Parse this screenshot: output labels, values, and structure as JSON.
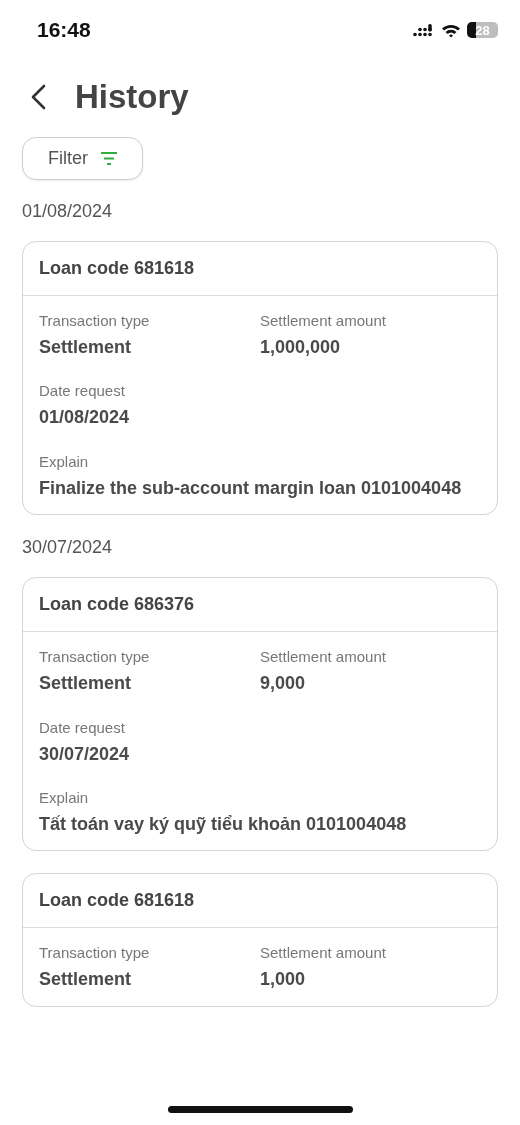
{
  "status_bar": {
    "time": "16:48",
    "battery": "28"
  },
  "header": {
    "title": "History"
  },
  "filter": {
    "label": "Filter"
  },
  "groups": [
    {
      "date": "01/08/2024",
      "cards": [
        {
          "title": "Loan code 681618",
          "fields": [
            {
              "kind": "half",
              "label": "Transaction type",
              "value": "Settlement"
            },
            {
              "kind": "half",
              "label": "Settlement amount",
              "value": "1,000,000"
            },
            {
              "kind": "full",
              "label": "Date request",
              "value": "01/08/2024"
            },
            {
              "kind": "full",
              "label": "Explain",
              "value": "Finalize the sub-account margin loan 0101004048"
            }
          ]
        }
      ]
    },
    {
      "date": "30/07/2024",
      "cards": [
        {
          "title": "Loan code 686376",
          "fields": [
            {
              "kind": "half",
              "label": "Transaction type",
              "value": "Settlement"
            },
            {
              "kind": "half",
              "label": "Settlement amount",
              "value": "9,000"
            },
            {
              "kind": "full",
              "label": "Date request",
              "value": "30/07/2024"
            },
            {
              "kind": "full",
              "label": "Explain",
              "value": "Tất toán vay ký quỹ tiểu khoản 0101004048"
            }
          ]
        },
        {
          "title": "Loan code 681618",
          "fields": [
            {
              "kind": "half",
              "label": "Transaction type",
              "value": "Settlement"
            },
            {
              "kind": "half",
              "label": "Settlement amount",
              "value": "1,000"
            }
          ]
        }
      ]
    }
  ]
}
